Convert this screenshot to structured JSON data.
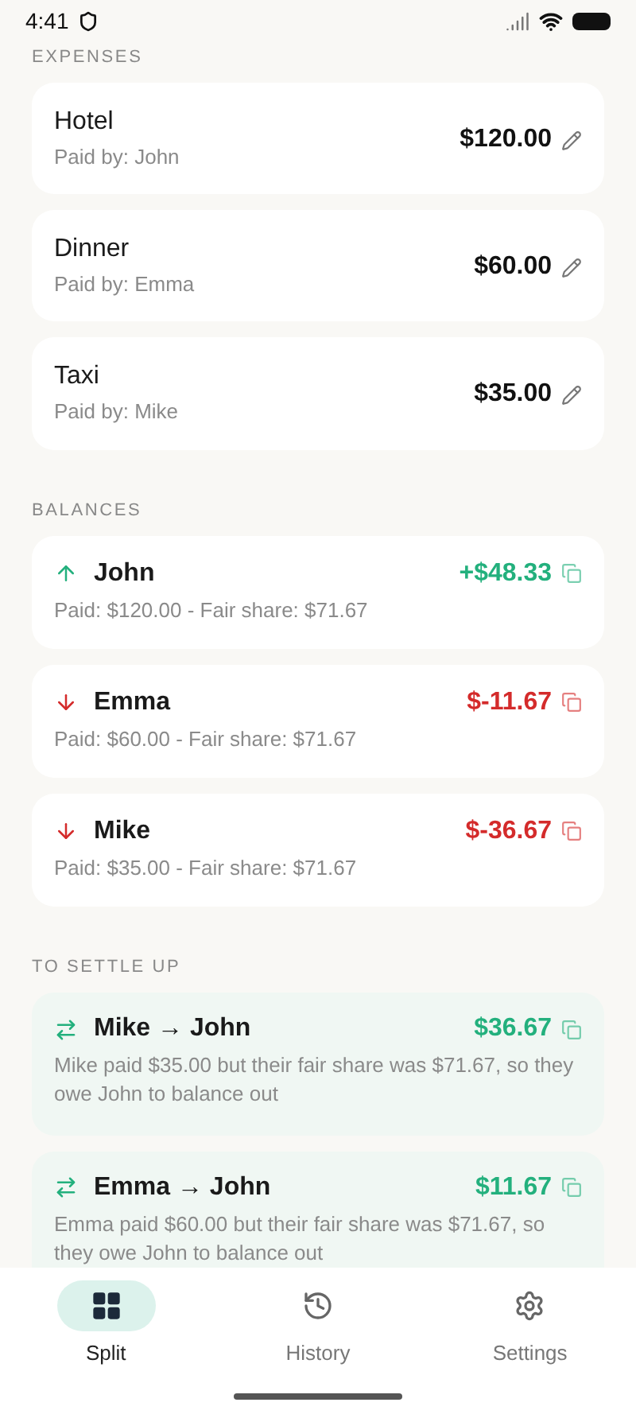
{
  "status_bar": {
    "time": "4:41"
  },
  "expenses": {
    "heading": "EXPENSES",
    "items": [
      {
        "name": "Hotel",
        "paid_by": "Paid by: John",
        "amount": "$120.00"
      },
      {
        "name": "Dinner",
        "paid_by": "Paid by: Emma",
        "amount": "$60.00"
      },
      {
        "name": "Taxi",
        "paid_by": "Paid by: Mike",
        "amount": "$35.00"
      }
    ]
  },
  "balances": {
    "heading": "BALANCES",
    "items": [
      {
        "name": "John",
        "kind": "up",
        "amount": "+$48.33",
        "detail": "Paid: $120.00 - Fair share: $71.67"
      },
      {
        "name": "Emma",
        "kind": "down",
        "amount": "$-11.67",
        "detail": "Paid: $60.00 - Fair share: $71.67"
      },
      {
        "name": "Mike",
        "kind": "down",
        "amount": "$-36.67",
        "detail": "Paid: $35.00 - Fair share: $71.67"
      }
    ]
  },
  "settle_up": {
    "heading": "TO SETTLE UP",
    "items": [
      {
        "title": "Mike → John",
        "amount": "$36.67",
        "detail": "Mike paid $35.00 but their fair share was $71.67, so they owe John to balance out"
      },
      {
        "title": "Emma → John",
        "amount": "$11.67",
        "detail": "Emma paid $60.00 but their fair share was $71.67, so they owe John to balance out"
      }
    ]
  },
  "bottom_nav": [
    {
      "label": "Split",
      "kind": "grid",
      "selected": true
    },
    {
      "label": "History",
      "kind": "history",
      "selected": false
    },
    {
      "label": "Settings",
      "kind": "gear",
      "selected": false
    }
  ]
}
